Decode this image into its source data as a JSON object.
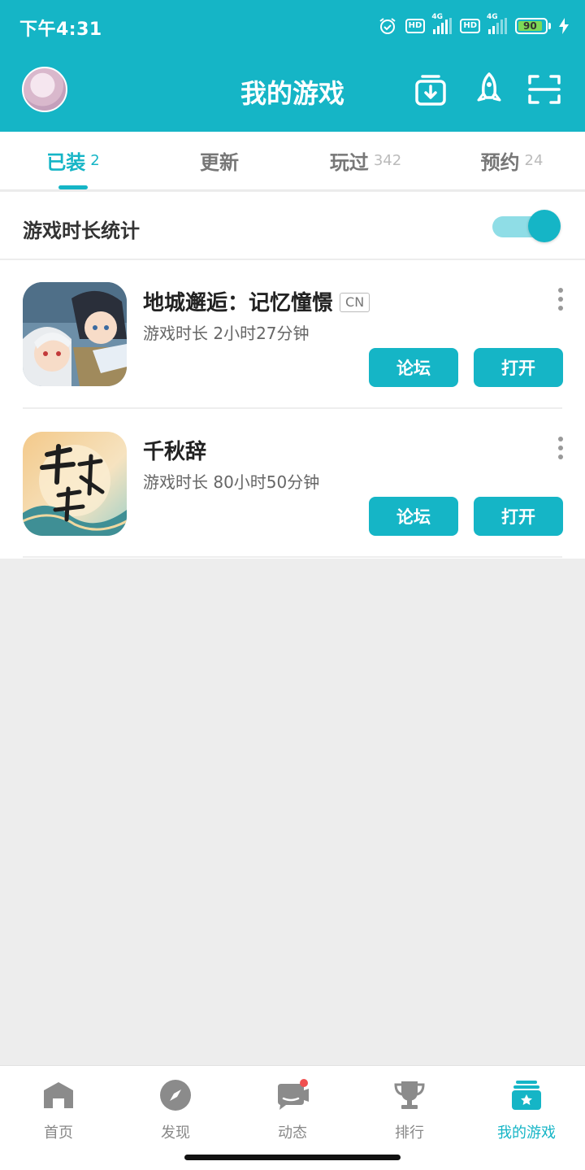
{
  "status_bar": {
    "time": "下午4:31",
    "network_1": "4G",
    "network_2": "4G",
    "hd": "HD",
    "battery": "90"
  },
  "header": {
    "title": "我的游戏"
  },
  "tabs": [
    {
      "label": "已装",
      "count": "2",
      "active": true
    },
    {
      "label": "更新",
      "count": "",
      "active": false
    },
    {
      "label": "玩过",
      "count": "342",
      "active": false
    },
    {
      "label": "预约",
      "count": "24",
      "active": false
    }
  ],
  "stats": {
    "label": "游戏时长统计",
    "toggle_on": true
  },
  "games": [
    {
      "name": "地城邂逅：记忆憧憬",
      "tag": "CN",
      "playtime": "游戏时长 2小时27分钟",
      "forum_label": "论坛",
      "open_label": "打开"
    },
    {
      "name": "千秋辞",
      "tag": "",
      "playtime": "游戏时长 80小时50分钟",
      "forum_label": "论坛",
      "open_label": "打开"
    }
  ],
  "bottom_nav": [
    {
      "label": "首页",
      "icon": "home-icon"
    },
    {
      "label": "发现",
      "icon": "compass-icon"
    },
    {
      "label": "动态",
      "icon": "chat-icon"
    },
    {
      "label": "排行",
      "icon": "trophy-icon"
    },
    {
      "label": "我的游戏",
      "icon": "my-games-icon",
      "active": true
    }
  ],
  "colors": {
    "accent": "#15b5c6",
    "background": "#ededed",
    "badge": "#f05050"
  }
}
